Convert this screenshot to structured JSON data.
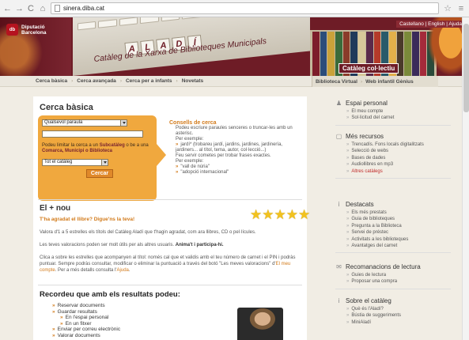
{
  "browser": {
    "url": "sinera.diba.cat",
    "back_icon": "back-arrow-icon",
    "forward_icon": "forward-arrow-icon",
    "reload_icon": "reload-icon",
    "home_icon": "home-icon",
    "star_icon": "bookmark-star-icon",
    "menu_icon": "menu-icon"
  },
  "header": {
    "logo_mark": "db",
    "logo_line1": "Diputació",
    "logo_line2": "Barcelona",
    "aladi_letters": [
      "A",
      "L",
      "A",
      "D",
      "Í"
    ],
    "subtitle": "Catàleg de la Xarxa de Biblioteques Municipals",
    "languages": "Castellano | English | Ajuda",
    "catalog_label": "Catàleg col·lectiu",
    "colors": {
      "brand": "#6e1c26",
      "accent": "#f0a83e"
    }
  },
  "navbar": {
    "links": [
      "Cerca bàsica",
      "Cerca avançada",
      "Cerca per a infants",
      "Novetats"
    ],
    "right_links": [
      "Biblioteca Virtual",
      "Web infantil Gènius"
    ]
  },
  "search": {
    "title": "Cerca bàsica",
    "field_select": "Qualsevol paraula",
    "query_value": "",
    "hint_pre": "Podeu limitar la cerca a un",
    "hint_sub": "Subcatàleg",
    "hint_mid": "o be a una",
    "hint_com": "Comarca, Municipi o Biblioteca",
    "catalog_select": "Tot el catàleg",
    "button": "Cercar"
  },
  "tips": {
    "title": "Consells de cerca",
    "line1": "Podeu escriure paraules senceres o truncar-les amb un asterisc.",
    "line2": "Per exemple:",
    "ex1": "jardí* (trobareu jardí, jardins, jardines, jardinería, jardiners... al títol, tema, autor, col·lecció...)",
    "line3": "Feu servir cometes per trobar frases exactes.",
    "line4": "Per exemple:",
    "ex2": "\"vall de núria\"",
    "ex3": "\"adopció internacional\""
  },
  "nou": {
    "title": "El + nou",
    "subtitle": "T'ha agradat el llibre? Digue'ns la teva!",
    "p1": "Valora d'1 a 5 estrelles els títols del Catàleg Aladí que t'hagin agradat, com ara llibres, CD o pel·lícules.",
    "p2_pre": "Les teves valoracions poden ser molt útils per als altres usuaris.",
    "p2_bold": "Anima't i participa-hi.",
    "p3_pre": "Clica a sobre les estrelles que acompanyen al títol: només cal que et validis amb el teu número de carnet i el PIN i podràs puntuar. Sempre podràs consultar, modificar o eliminar la puntuació a través del botó \"Les meves valoracions\" d'",
    "p3_link1": "El meu compte",
    "p3_mid": ". Per a més detalls consulta l'",
    "p3_link2": "Ajuda",
    "p3_end": ".",
    "stars": 5
  },
  "recordeu": {
    "title": "Recordeu que amb els resultats podeu:",
    "items": [
      {
        "label": "Reservar documents",
        "sub": false
      },
      {
        "label": "Guardar resultats",
        "sub": false
      },
      {
        "label": "En l'espai personal",
        "sub": true
      },
      {
        "label": "En un fitxer",
        "sub": true
      },
      {
        "label": "Enviar per correu electrònic",
        "sub": false
      },
      {
        "label": "Valorar documents",
        "sub": false
      }
    ]
  },
  "sidebar": {
    "groups": [
      {
        "title": "Espai personal",
        "icon": "person-icon",
        "items": [
          {
            "label": "El meu compte"
          },
          {
            "label": "Sol·licitud del carnet"
          }
        ]
      },
      {
        "title": "Més recursos",
        "icon": "resources-icon",
        "items": [
          {
            "label": "Trencadís. Fons locals digitalitzats"
          },
          {
            "label": "Selecció de webs"
          },
          {
            "label": "Bases de dades"
          },
          {
            "label": "Audiollibres en mp3"
          },
          {
            "label": "Altres catàlegs",
            "red": true
          }
        ]
      },
      {
        "title": "Destacats",
        "icon": "highlight-icon",
        "items": [
          {
            "label": "Els més prestats"
          },
          {
            "label": "Guia de biblioteques"
          },
          {
            "label": "Pregunta a la Biblioteca"
          },
          {
            "label": "Servei de préstec"
          },
          {
            "label": "Activitats a les biblioteques"
          },
          {
            "label": "Avantatges del carnet"
          }
        ]
      },
      {
        "title": "Recomanacions de lectura",
        "icon": "chat-icon",
        "items": [
          {
            "label": "Guies de lectura"
          },
          {
            "label": "Proposar una compra"
          }
        ]
      },
      {
        "title": "Sobre el catàleg",
        "icon": "info-icon",
        "items": [
          {
            "label": "Què és l'Aladí?"
          },
          {
            "label": "Bústia de suggeriments"
          },
          {
            "label": "MiniAladí"
          }
        ]
      }
    ]
  }
}
